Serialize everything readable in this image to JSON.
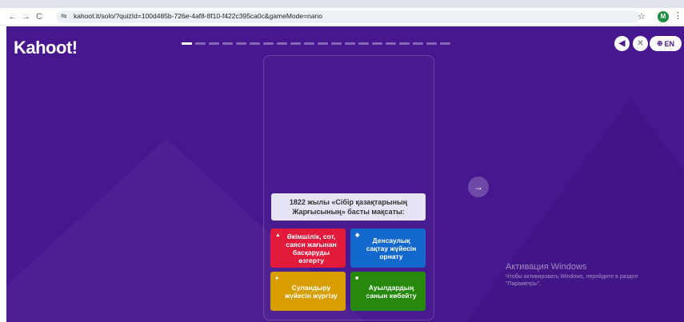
{
  "browser": {
    "back": "←",
    "forward": "→",
    "reload": "C",
    "site_icon": "⇋",
    "url": "kahoot.it/solo/?quizId=100d485b-726e-4af8-8f10-f422c395ca0c&gameMode=nano",
    "star": "☆",
    "profile": "M",
    "menu": "⋮"
  },
  "game": {
    "logo": "Kahoot!",
    "progress": {
      "total": 20,
      "current": 1
    },
    "sound_icon": "◀",
    "close_icon": "✕",
    "language_icon": "⊕",
    "language": "EN",
    "question": "1822 жылы «Сібір қазақтарының Жарғысының» басты мақсаты:",
    "answers": [
      {
        "shape": "▲",
        "text": "Әкімшілік, сот, саяси жағынан басқаруды өзгерту",
        "color": "#e21b3c"
      },
      {
        "shape": "◆",
        "text": "Денсаулық сақтау жүйесін орнату",
        "color": "#1368ce"
      },
      {
        "shape": "●",
        "text": "Суландыру жүйесін жүргізу",
        "color": "#d89e00"
      },
      {
        "shape": "■",
        "text": "Ауылдардың санын көбейту",
        "color": "#26890c"
      }
    ],
    "next": "→",
    "background_color": "#46178f"
  },
  "watermark": {
    "title": "Активация Windows",
    "subtitle": "Чтобы активировать Windows, перейдите в раздел \"Параметры\"."
  }
}
